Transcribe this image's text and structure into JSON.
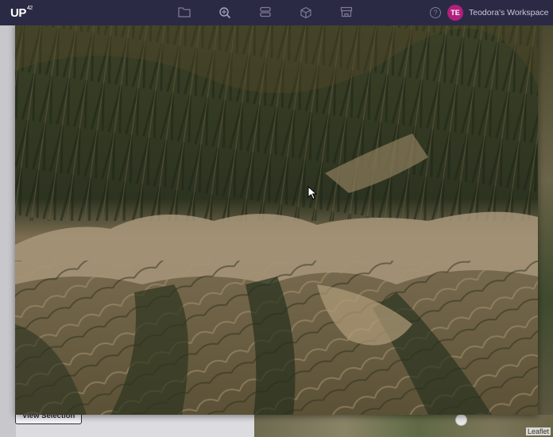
{
  "navbar": {
    "logo": "UP",
    "logo_sup": "42",
    "icons": [
      "folder-icon",
      "search-data-icon",
      "storage-icon",
      "cube-icon",
      "store-icon"
    ],
    "help_label": "?",
    "avatar_initials": "TE",
    "workspace_label": "Teodora's Workspace"
  },
  "page": {
    "view_selection_label": "View Selection",
    "attribution": "Leaflet"
  },
  "colors": {
    "navbar": "#2b2a45",
    "avatar": "#b31f7c",
    "nav_icon": "#7d7b95"
  }
}
